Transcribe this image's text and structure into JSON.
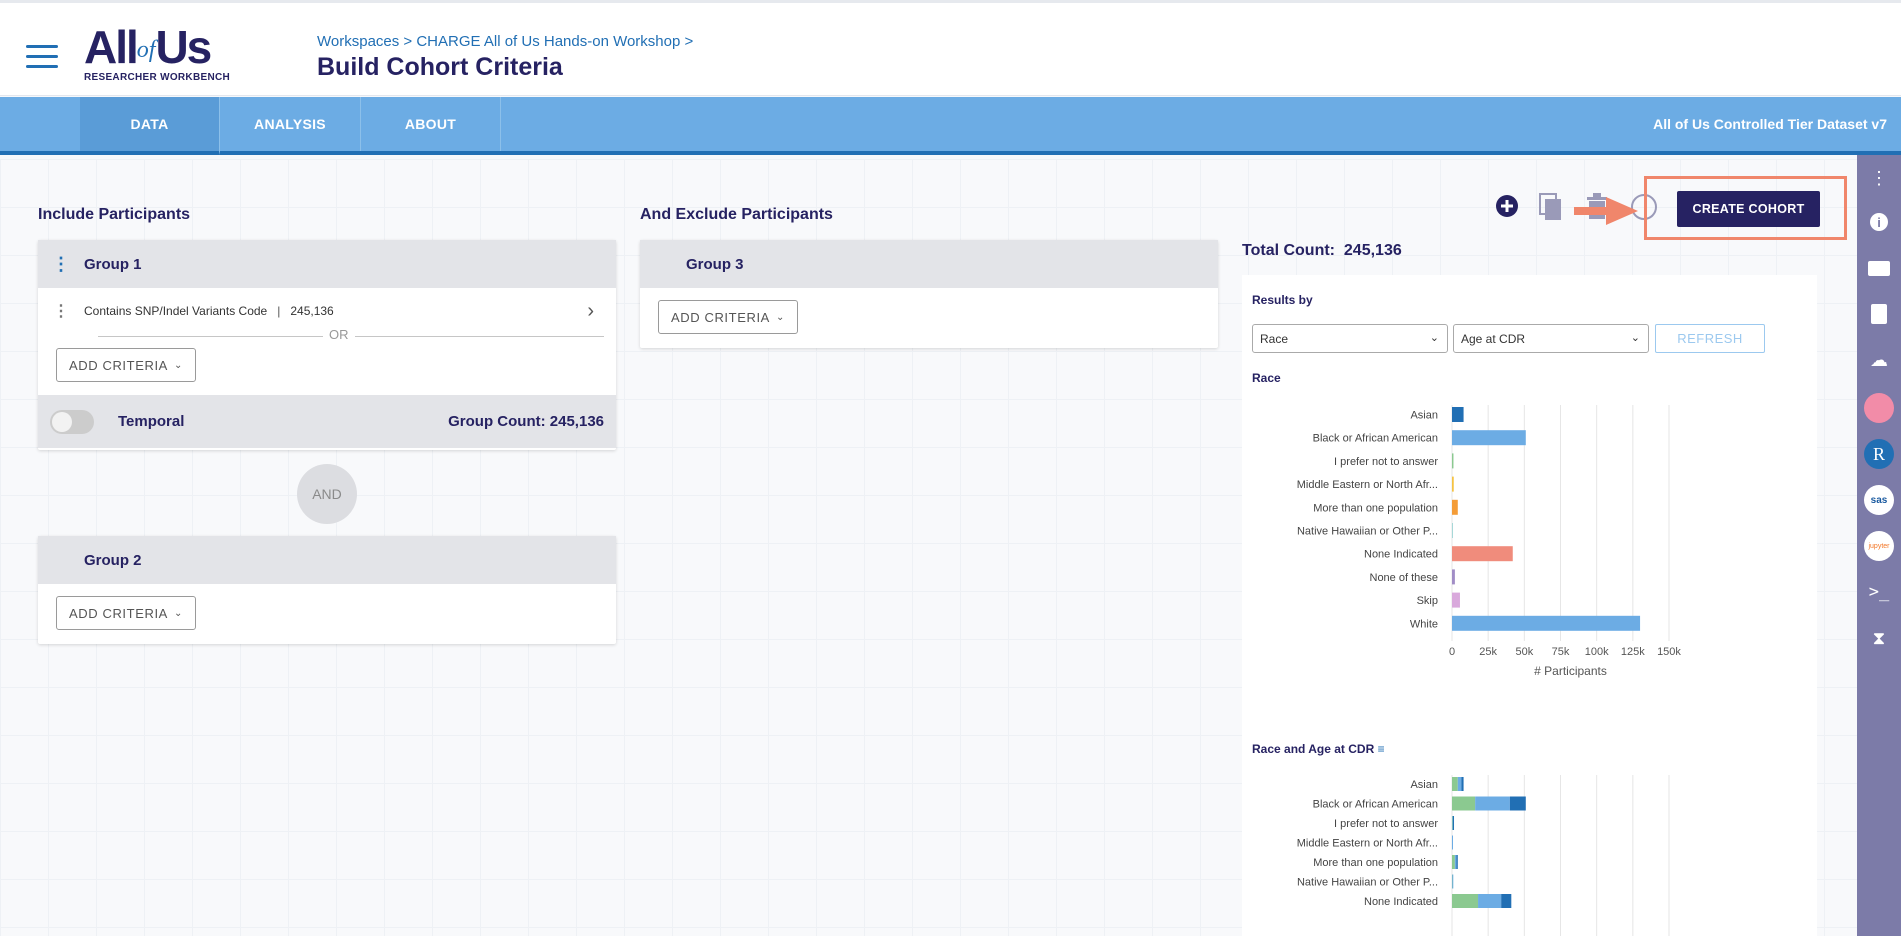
{
  "header": {
    "logo_main": "All",
    "logo_of": "of",
    "logo_us": "Us",
    "logo_sub": "RESEARCHER WORKBENCH",
    "breadcrumb": "Workspaces > CHARGE All of Us Hands-on Workshop >",
    "title": "Build Cohort Criteria"
  },
  "nav": {
    "tabs": [
      {
        "label": "DATA",
        "active": true
      },
      {
        "label": "ANALYSIS",
        "active": false
      },
      {
        "label": "ABOUT",
        "active": false
      }
    ],
    "dataset": "All of Us Controlled Tier Dataset v7"
  },
  "include": {
    "title": "Include Participants",
    "group1": {
      "name": "Group 1",
      "criterion": "Contains SNP/Indel Variants Code",
      "criterion_count": "245,136",
      "or_label": "OR",
      "add_label": "ADD CRITERIA",
      "temporal_label": "Temporal",
      "group_count": "Group Count: 245,136"
    },
    "and_label": "AND",
    "group2": {
      "name": "Group 2",
      "add_label": "ADD CRITERIA"
    }
  },
  "exclude": {
    "title": "And Exclude Participants",
    "group3": {
      "name": "Group 3",
      "add_label": "ADD CRITERIA"
    }
  },
  "toolbar": {
    "create_label": "CREATE COHORT"
  },
  "results": {
    "total_label": "Total Count:",
    "total_value": "245,136",
    "results_by": "Results by",
    "select1": "Race",
    "select2": "Age at CDR",
    "refresh": "REFRESH",
    "chart1_title": "Race",
    "chart2_title": "Race and Age at CDR"
  },
  "colors": {
    "navy": "#262262",
    "blue": "#216fb4",
    "light_blue": "#6cace4",
    "highlight": "#f0866b"
  },
  "sidebar_icons": [
    "kebab-icon",
    "info-icon",
    "folder-icon",
    "notebook-icon",
    "cloud-icon",
    "rstudio-icon",
    "r-icon",
    "sas-icon",
    "jupyter-icon",
    "terminal-icon",
    "hourglass-icon"
  ],
  "chart_data": [
    {
      "type": "bar",
      "orientation": "horizontal",
      "title": "Race",
      "categories": [
        "Asian",
        "Black or African American",
        "I prefer not to answer",
        "Middle Eastern or North Afr...",
        "More than one population",
        "Native Hawaiian or Other P...",
        "None Indicated",
        "None of these",
        "Skip",
        "White"
      ],
      "values": [
        8000,
        51000,
        1000,
        1200,
        4000,
        300,
        42000,
        2000,
        5500,
        130000
      ],
      "colors": [
        "#216fb4",
        "#6cace4",
        "#8bc990",
        "#f5c342",
        "#f49c37",
        "#a7d8d8",
        "#f08c7c",
        "#a18dc6",
        "#d9a9dc",
        "#6cace4"
      ],
      "xticks": [
        "0",
        "25k",
        "50k",
        "75k",
        "100k",
        "125k",
        "150k"
      ],
      "xlim": [
        0,
        150000
      ],
      "xlabel": "# Participants",
      "grid": true
    },
    {
      "type": "bar",
      "orientation": "horizontal",
      "stacked": true,
      "title": "Race and Age at CDR",
      "categories": [
        "Asian",
        "Black or African American",
        "I prefer not to answer",
        "Middle Eastern or North Afr...",
        "More than one population",
        "Native Hawaiian or Other P...",
        "None Indicated"
      ],
      "series": [
        {
          "color": "#8bc990",
          "values": [
            4000,
            16000,
            300,
            0,
            2000,
            200,
            18000
          ]
        },
        {
          "color": "#6cace4",
          "values": [
            2500,
            24000,
            400,
            0,
            1000,
            100,
            16000
          ]
        },
        {
          "color": "#216fb4",
          "values": [
            1500,
            11000,
            300,
            0,
            1000,
            0,
            7000
          ]
        }
      ],
      "xlim": [
        0,
        150000
      ]
    }
  ]
}
